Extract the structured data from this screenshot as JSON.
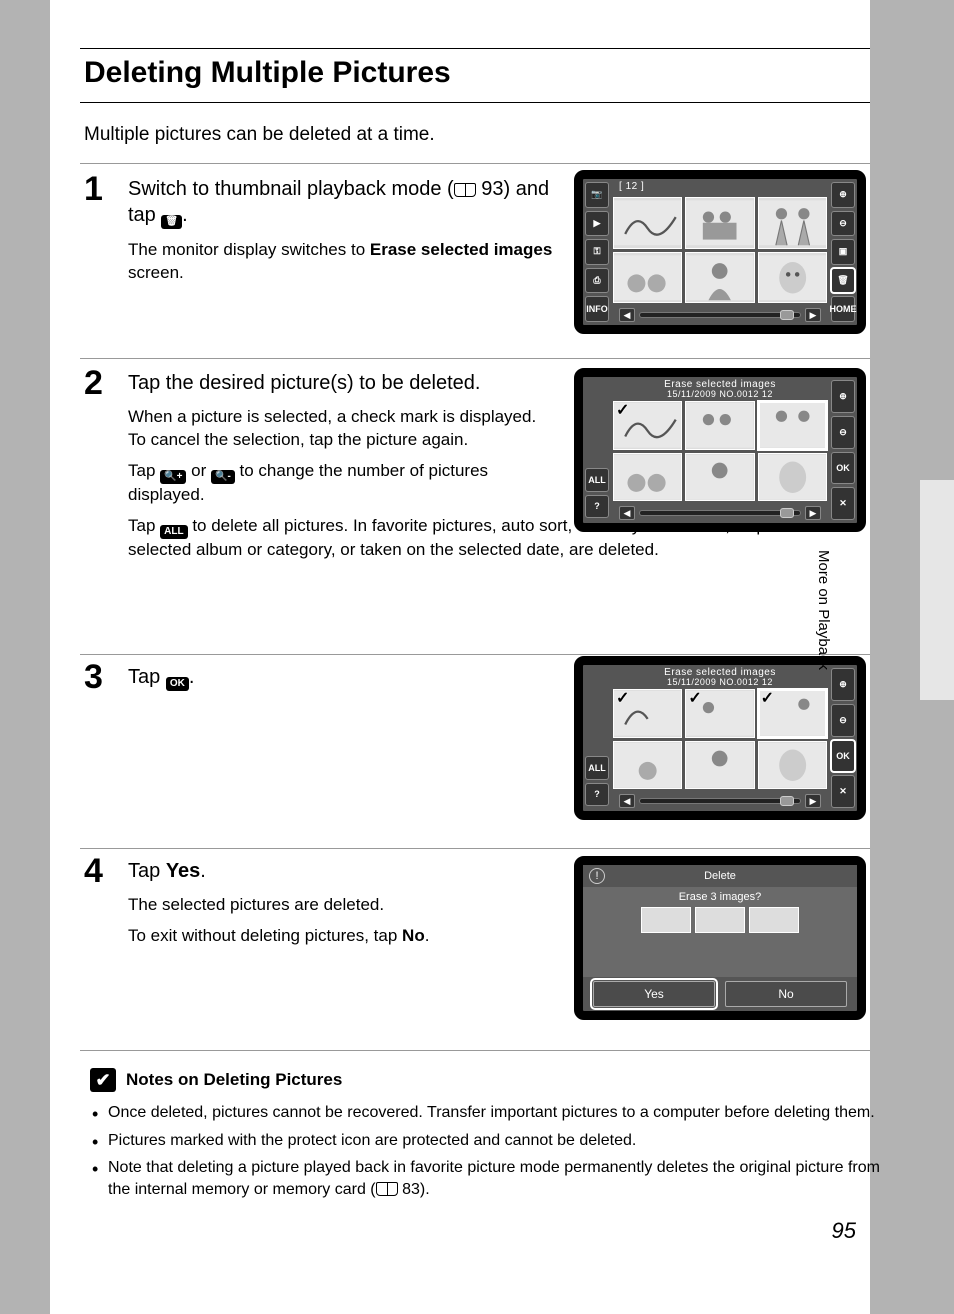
{
  "pageTitle": "Deleting Multiple Pictures",
  "intro": "Multiple pictures can be deleted at a time.",
  "sideLabel": "More on Playback",
  "pageNum": "95",
  "steps": {
    "s1": {
      "num": "1",
      "head_a": "Switch to thumbnail playback mode (",
      "head_ref": "93",
      "head_b": ") and tap ",
      "head_c": ".",
      "body_a": "The monitor display switches to ",
      "body_bold": "Erase selected images",
      "body_b": " screen."
    },
    "s2": {
      "num": "2",
      "head": "Tap the desired picture(s) to be deleted.",
      "body1": "When a picture is selected, a check mark is displayed. To cancel the selection, tap the picture again.",
      "body2a": "Tap ",
      "body2b": " or ",
      "body2c": " to change the number of pictures displayed.",
      "body3a": "Tap ",
      "body3b": " to delete all pictures. In favorite pictures, auto sort, or list by date mode, all pictures in the selected album or category, or taken on the selected date, are deleted."
    },
    "s3": {
      "num": "3",
      "head_a": "Tap ",
      "head_b": "."
    },
    "s4": {
      "num": "4",
      "head_a": "Tap ",
      "head_bold": "Yes",
      "head_b": ".",
      "body1": "The selected pictures are deleted.",
      "body2a": "To exit without deleting pictures, tap ",
      "body2bold": "No",
      "body2b": "."
    }
  },
  "screens": {
    "s1": {
      "topCount": "12",
      "leftIcons": [
        "📷",
        "▶",
        "⚿",
        "⎙",
        "INFO"
      ],
      "rightIcons": [
        "⊕",
        "⊖",
        "▣",
        "🗑",
        "HOME"
      ]
    },
    "s2": {
      "title": "Erase selected images",
      "info": "15/11/2009  NO.0012    12",
      "leftIcons": [
        "ALL",
        "?"
      ],
      "rightIcons": [
        "⊕",
        "⊖",
        "OK",
        "✕"
      ]
    },
    "s3": {
      "title": "Erase selected images",
      "info": "15/11/2009  NO.0012    12",
      "leftIcons": [
        "ALL",
        "?"
      ],
      "rightIcons": [
        "⊕",
        "⊖",
        "OK",
        "✕"
      ]
    },
    "s4": {
      "title": "Delete",
      "question": "Erase 3 images?",
      "yes": "Yes",
      "no": "No"
    }
  },
  "notes": {
    "heading": "Notes on Deleting Pictures",
    "items": [
      "Once deleted, pictures cannot be recovered. Transfer important pictures to a computer before deleting them.",
      "Pictures marked with the protect icon are protected and cannot be deleted."
    ],
    "item3a": "Note that deleting a picture played back in favorite picture mode permanently deletes the original picture from the internal memory or memory card (",
    "item3ref": "83",
    "item3b": ")."
  }
}
